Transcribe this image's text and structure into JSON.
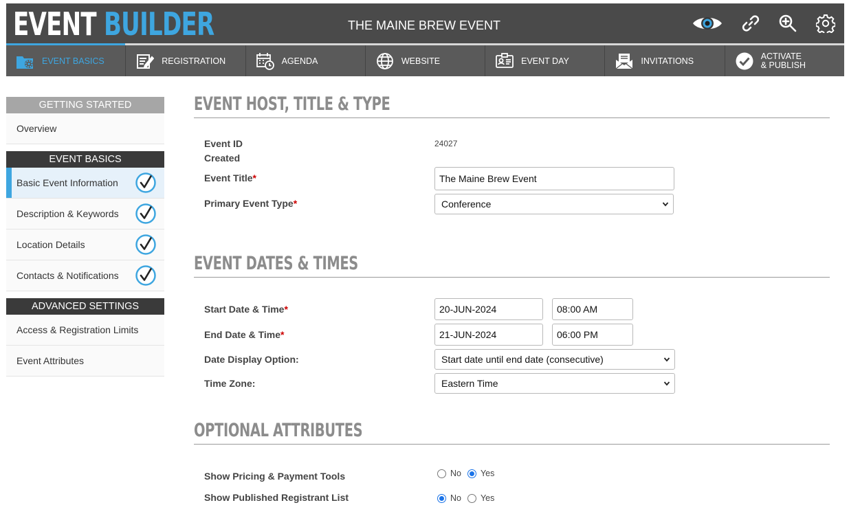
{
  "header": {
    "logo_word1": "EVENT",
    "logo_word2": "BUILDER",
    "event_name": "THE MAINE BREW EVENT",
    "icons": [
      "eye-icon",
      "link-icon",
      "zoom-icon",
      "gear-icon"
    ]
  },
  "nav": {
    "items": [
      {
        "label": "EVENT BASICS",
        "icon": "event-basics-icon",
        "active": true
      },
      {
        "label": "REGISTRATION",
        "icon": "registration-icon"
      },
      {
        "label": "AGENDA",
        "icon": "agenda-icon"
      },
      {
        "label": "WEBSITE",
        "icon": "globe-icon"
      },
      {
        "label": "EVENT DAY",
        "icon": "badge-icon"
      },
      {
        "label": "INVITATIONS",
        "icon": "envelope-icon"
      },
      {
        "label_line1": "ACTIVATE",
        "label_line2": "& PUBLISH",
        "icon": "check-circle-icon"
      }
    ]
  },
  "sidebar": {
    "getting_started": {
      "heading": "GETTING STARTED",
      "items": [
        "Overview"
      ]
    },
    "event_basics": {
      "heading": "EVENT BASICS",
      "items": [
        "Basic Event Information",
        "Description & Keywords",
        "Location Details",
        "Contacts & Notifications"
      ]
    },
    "advanced": {
      "heading": "ADVANCED SETTINGS",
      "items": [
        "Access & Registration Limits",
        "Event Attributes"
      ]
    }
  },
  "section1": {
    "title": "EVENT HOST, TITLE & TYPE",
    "event_id_label": "Event ID",
    "event_id_value": "24027",
    "created_label": "Created",
    "title_label": "Event Title",
    "title_value": "The Maine Brew Event",
    "type_label": "Primary Event Type",
    "type_value": "Conference",
    "required_mark": "*"
  },
  "section2": {
    "title": "EVENT DATES & TIMES",
    "start_label": "Start Date & Time",
    "start_date": "20-JUN-2024",
    "start_time": "08:00 AM",
    "end_label": "End Date & Time",
    "end_date": "21-JUN-2024",
    "end_time": "06:00 PM",
    "display_label": "Date Display Option:",
    "display_value": "Start date until end date (consecutive)",
    "tz_label": "Time Zone:",
    "tz_value": "Eastern Time"
  },
  "section3": {
    "title": "OPTIONAL ATTRIBUTES",
    "pricing_label": "Show Pricing & Payment Tools",
    "pricing_value": "Yes",
    "registrant_label": "Show Published Registrant List",
    "registrant_value": "No",
    "opt_no": "No",
    "opt_yes": "Yes"
  },
  "colors": {
    "accent": "#3ea6e0",
    "header_bg": "#4a4a4a",
    "nav_bg": "#5a5a5a",
    "required": "#cc0000"
  }
}
